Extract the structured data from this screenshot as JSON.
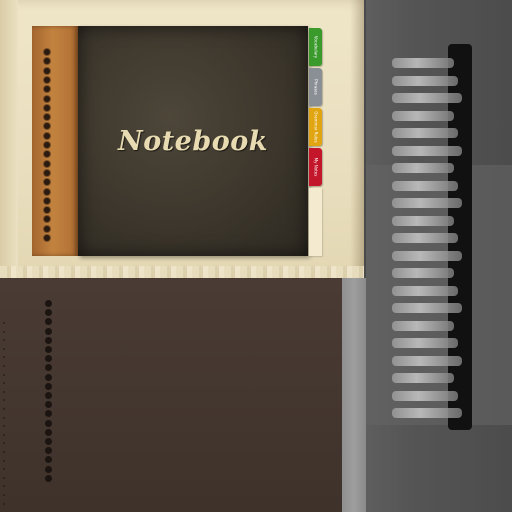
{
  "cover": {
    "title": "Notebook"
  },
  "tabs": [
    {
      "label": "Vocabulary",
      "color": "#3a9a2c"
    },
    {
      "label": "Phrases",
      "color": "#8a8f95"
    },
    {
      "label": "Grammar Rules",
      "color": "#e0a510"
    },
    {
      "label": "My Notes",
      "color": "#c4162a"
    }
  ],
  "colors": {
    "cream_page": "#ebe1c2",
    "cover_leather": "#3c362c",
    "spine_leather": "#b57436",
    "title_gold": "#e8dbb2",
    "brown_page": "#43362f",
    "gray_map": "#555555"
  }
}
